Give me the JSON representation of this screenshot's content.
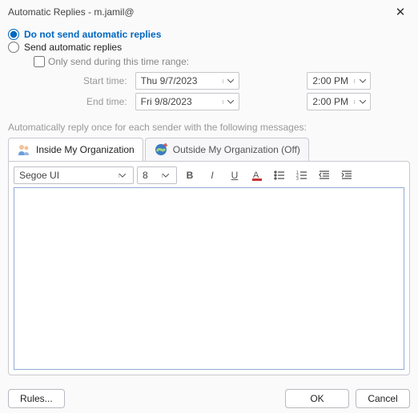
{
  "window": {
    "title": "Automatic Replies - m.jamil@"
  },
  "options": {
    "do_not_send": "Do not send automatic replies",
    "send": "Send automatic replies"
  },
  "time_range": {
    "only_send": "Only send during this time range:",
    "start_label": "Start time:",
    "start_date": "Thu 9/7/2023",
    "start_time": "2:00 PM",
    "end_label": "End time:",
    "end_date": "Fri 9/8/2023",
    "end_time": "2:00 PM"
  },
  "helper": "Automatically reply once for each sender with the following messages:",
  "tabs": {
    "inside": "Inside My Organization",
    "outside": "Outside My Organization (Off)"
  },
  "toolbar": {
    "font": "Segoe UI",
    "size": "8"
  },
  "buttons": {
    "rules": "Rules...",
    "ok": "OK",
    "cancel": "Cancel"
  }
}
